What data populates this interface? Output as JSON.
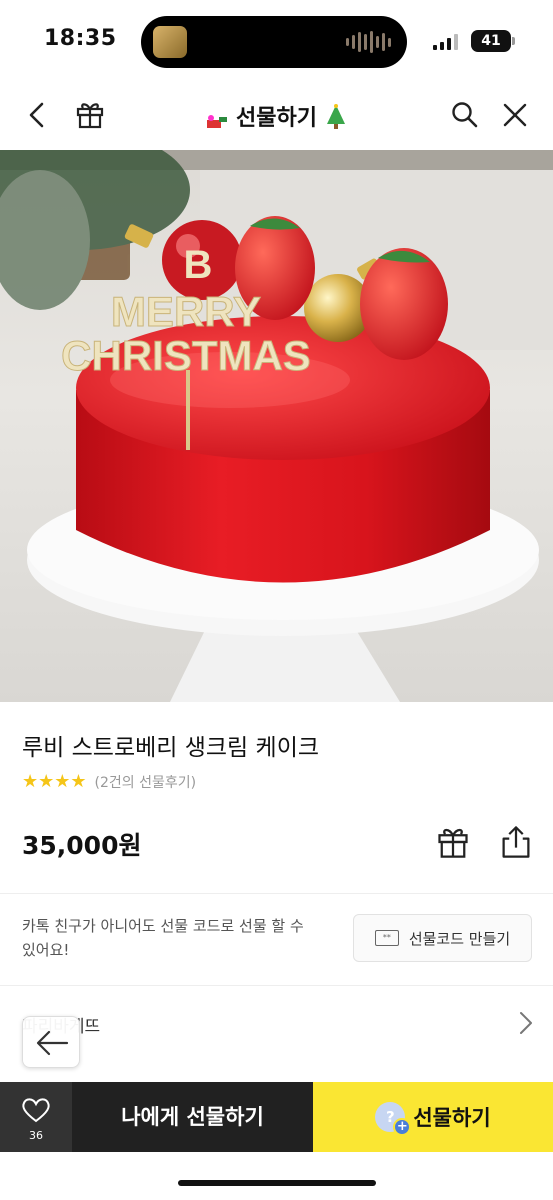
{
  "status_bar": {
    "time": "18:35",
    "battery": "41"
  },
  "nav": {
    "title": "선물하기"
  },
  "hero": {
    "topper_line1": "MERRY",
    "topper_line2": "CHRISTMAS",
    "monogram": "B"
  },
  "product": {
    "name": "루비 스트로베리 생크림 케이크",
    "stars": "★★★★",
    "review_count": "(2건의 선물후기)",
    "price": "35,000원"
  },
  "promo": {
    "text": "카톡 친구가 아니어도 선물 코드로 선물 할 수 있어요!",
    "ticket_icon_text": "**",
    "button_label": "선물코드 만들기"
  },
  "row": {
    "label": "파리바게뜨"
  },
  "bottom_bar": {
    "like_count": "36",
    "self_gift_label": "나에게 선물하기",
    "gift_avatar_symbol": "?",
    "gift_label": "선물하기"
  },
  "icons": [
    "back-icon",
    "gift-box-icon",
    "search-icon",
    "close-icon",
    "share-icon",
    "ticket-icon",
    "chevron-right-icon",
    "arrow-left-icon",
    "heart-icon"
  ],
  "colors": {
    "accent_yellow": "#fae633",
    "dark_button": "#212121",
    "star": "#f5c518",
    "cake_red": "#d8141c"
  }
}
